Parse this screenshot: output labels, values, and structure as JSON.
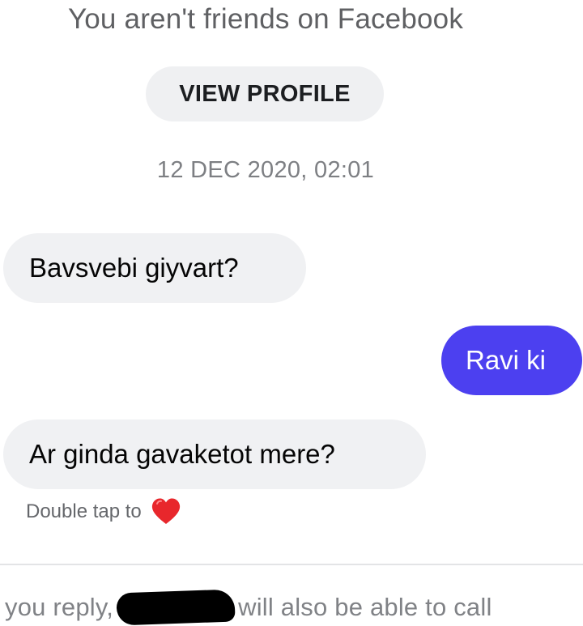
{
  "header": {
    "friend_status": "You aren't friends on Facebook",
    "view_profile_label": "VIEW PROFILE"
  },
  "conversation": {
    "timestamp": "12 DEC 2020, 02:01",
    "messages": [
      {
        "direction": "incoming",
        "text": "Bavsvebi giyvart?"
      },
      {
        "direction": "outgoing",
        "text": "Ravi ki"
      },
      {
        "direction": "incoming",
        "text": "Ar ginda gavaketot mere?"
      }
    ],
    "reaction_hint": "Double tap to",
    "reaction_icon": "heart-icon"
  },
  "footer": {
    "note_before": "you reply,",
    "note_after": "will also be able to call"
  },
  "colors": {
    "outgoing_bubble": "#4c40f0",
    "incoming_bubble": "#f0f1f3",
    "heart": "#e8272c"
  }
}
